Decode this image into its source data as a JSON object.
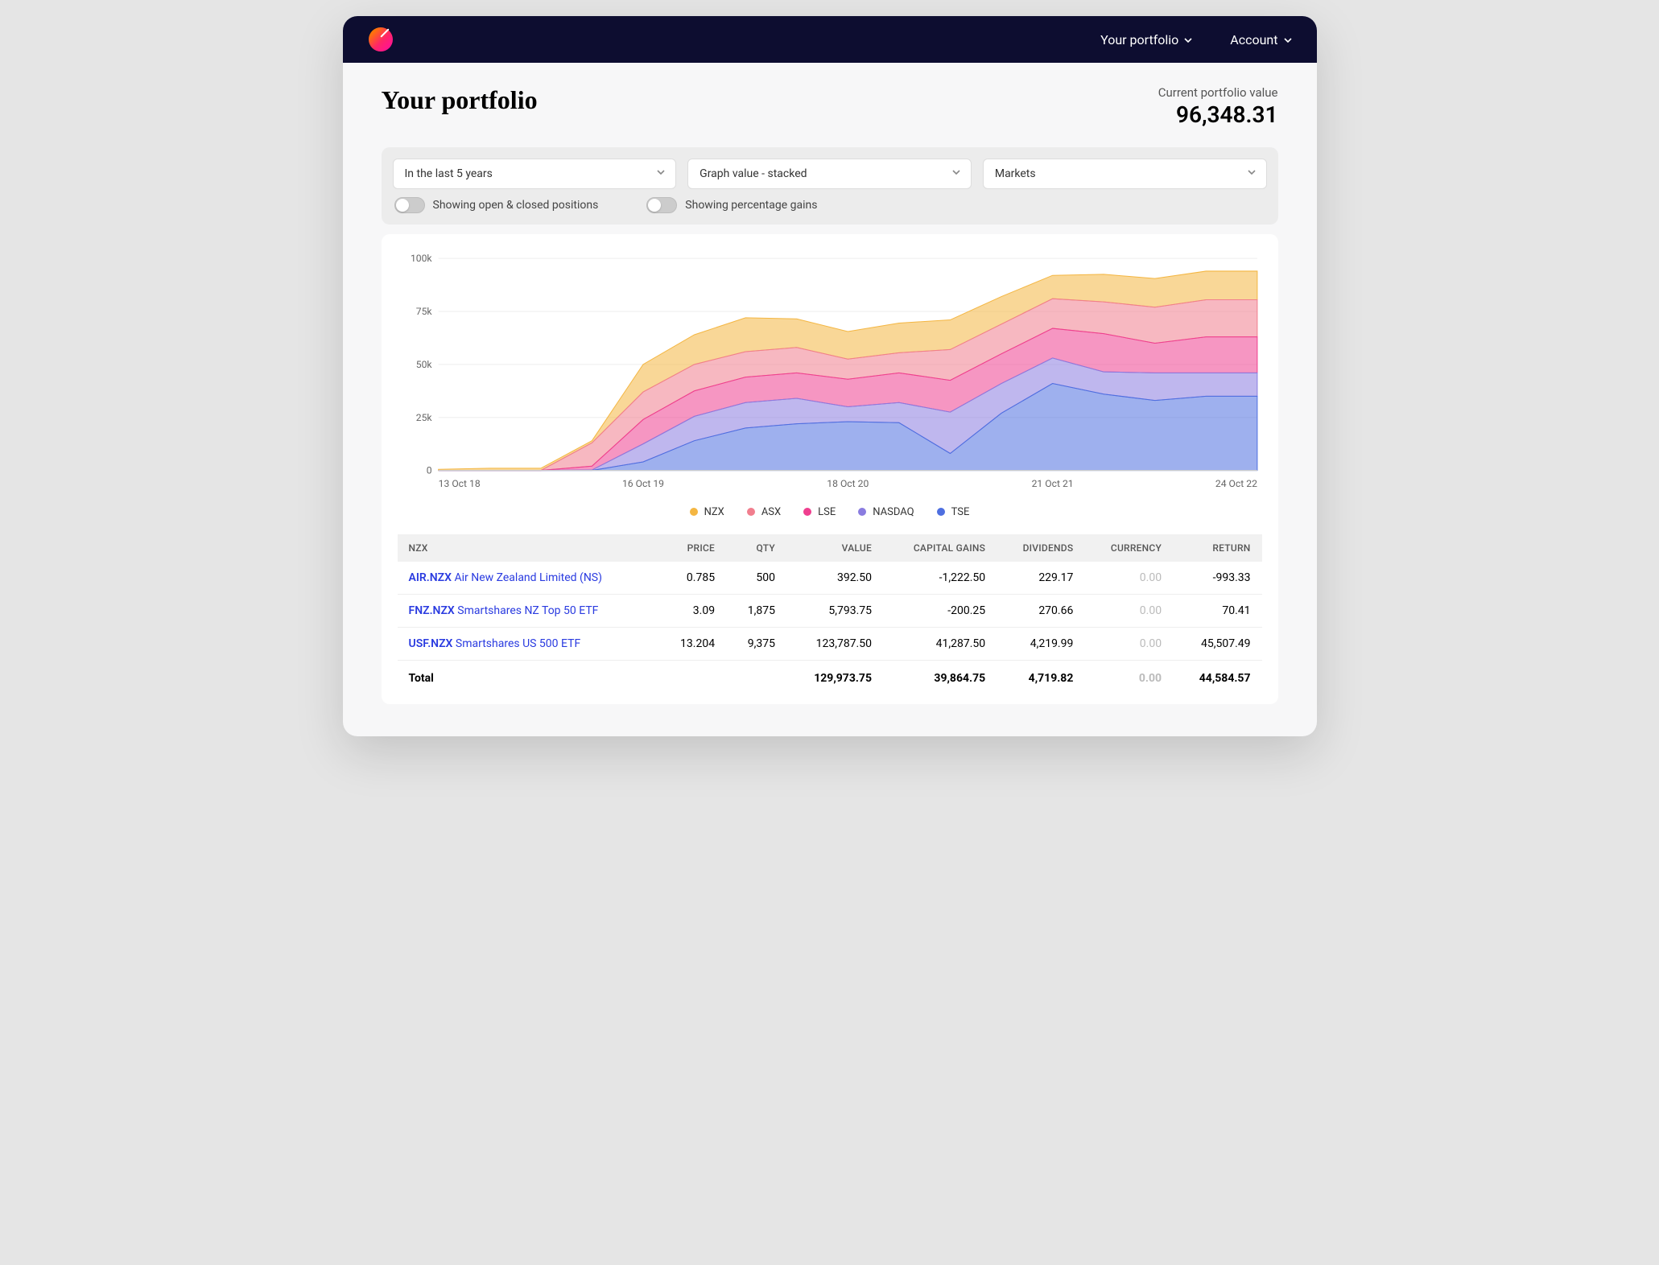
{
  "nav": {
    "portfolio": "Your portfolio",
    "account": "Account"
  },
  "header": {
    "title": "Your portfolio",
    "value_label": "Current portfolio value",
    "value": "96,348.31"
  },
  "controls": {
    "range_select": "In the last 5 years",
    "mode_select": "Graph value - stacked",
    "group_select": "Markets",
    "toggle_positions": "Showing open & closed positions",
    "toggle_percent": "Showing percentage gains"
  },
  "legend": {
    "nzx": "NZX",
    "asx": "ASX",
    "lse": "LSE",
    "nasdaq": "NASDAQ",
    "tse": "TSE"
  },
  "colors": {
    "nzx": "#f4b642",
    "asx": "#f17e8e",
    "lse": "#ef3f8f",
    "nasdaq": "#8a7ce0",
    "tse": "#4e6fe0"
  },
  "chart_data": {
    "type": "area",
    "title": "",
    "xlabel": "",
    "ylabel": "",
    "ylim": [
      0,
      100000
    ],
    "y_ticks": [
      0,
      25000,
      50000,
      75000,
      100000
    ],
    "y_tick_labels": [
      "0",
      "25k",
      "50k",
      "75k",
      "100k"
    ],
    "x_ticks_indices": [
      0,
      4,
      8,
      12,
      16
    ],
    "x_tick_labels": [
      "13 Oct 18",
      "16 Oct 19",
      "18 Oct 20",
      "21 Oct 21",
      "24 Oct 22"
    ],
    "series": [
      {
        "name": "TSE",
        "color": "#4e6fe0",
        "values": [
          0,
          0,
          0,
          0,
          4000,
          14000,
          20000,
          22000,
          23000,
          22500,
          8000,
          27000,
          41000,
          36000,
          33000,
          35000,
          35000
        ]
      },
      {
        "name": "NASDAQ",
        "color": "#8a7ce0",
        "values": [
          0,
          0,
          0,
          200,
          8500,
          11500,
          12000,
          12000,
          7000,
          9500,
          19500,
          14000,
          12000,
          10500,
          13000,
          11000,
          11000
        ]
      },
      {
        "name": "LSE",
        "color": "#ef3f8f",
        "values": [
          0,
          0,
          0,
          1800,
          11500,
          12000,
          12000,
          12000,
          13000,
          14000,
          15000,
          14000,
          14000,
          18000,
          14000,
          17000,
          17000
        ]
      },
      {
        "name": "ASX",
        "color": "#f17e8e",
        "values": [
          0,
          0,
          0,
          11000,
          13000,
          12500,
          12000,
          12000,
          9500,
          9500,
          14500,
          14000,
          14000,
          15000,
          17000,
          17500,
          17500
        ]
      },
      {
        "name": "NZX",
        "color": "#f4b642",
        "values": [
          500,
          1000,
          1000,
          1000,
          13000,
          14000,
          16000,
          13500,
          13000,
          14000,
          14000,
          13000,
          11000,
          13000,
          13500,
          13500,
          13500
        ]
      }
    ]
  },
  "table": {
    "section": "NZX",
    "headers": {
      "price": "PRICE",
      "qty": "QTY",
      "value": "VALUE",
      "capital_gains": "CAPITAL GAINS",
      "dividends": "DIVIDENDS",
      "currency": "CURRENCY",
      "return": "RETURN"
    },
    "rows": [
      {
        "ticker": "AIR.NZX",
        "name": "Air New Zealand Limited (NS)",
        "price": "0.785",
        "qty": "500",
        "value": "392.50",
        "capital_gains": "-1,222.50",
        "dividends": "229.17",
        "currency": "0.00",
        "return": "-993.33"
      },
      {
        "ticker": "FNZ.NZX",
        "name": "Smartshares NZ Top 50 ETF",
        "price": "3.09",
        "qty": "1,875",
        "value": "5,793.75",
        "capital_gains": "-200.25",
        "dividends": "270.66",
        "currency": "0.00",
        "return": "70.41"
      },
      {
        "ticker": "USF.NZX",
        "name": "Smartshares US 500 ETF",
        "price": "13.204",
        "qty": "9,375",
        "value": "123,787.50",
        "capital_gains": "41,287.50",
        "dividends": "4,219.99",
        "currency": "0.00",
        "return": "45,507.49"
      }
    ],
    "total": {
      "label": "Total",
      "value": "129,973.75",
      "capital_gains": "39,864.75",
      "dividends": "4,719.82",
      "currency": "0.00",
      "return": "44,584.57"
    }
  }
}
